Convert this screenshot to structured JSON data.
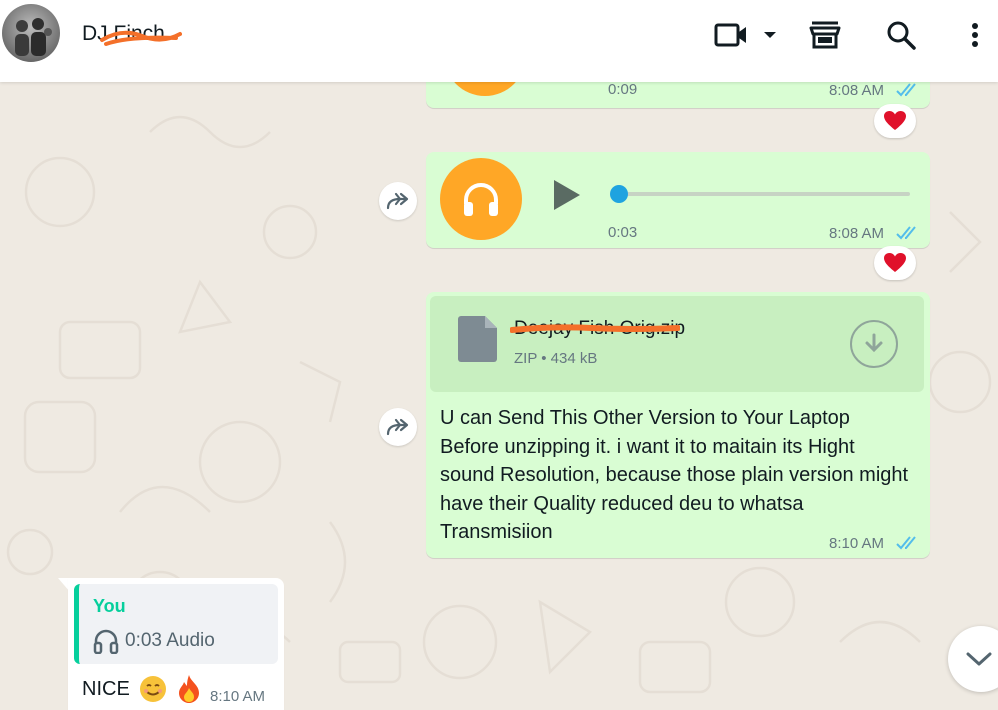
{
  "header": {
    "contact_name": "DJ Finch",
    "icons": [
      "video-call-icon",
      "dropdown-chevron-icon",
      "shop-icon",
      "search-icon",
      "menu-dots-icon"
    ]
  },
  "messages": {
    "audio1": {
      "duration": "0:09",
      "time": "8:08 AM",
      "reaction": "heart"
    },
    "audio2": {
      "duration": "0:03",
      "time": "8:08 AM",
      "reaction": "heart"
    },
    "file": {
      "file_name": "Deejay Fish Orig.zip",
      "file_type": "ZIP",
      "file_size": "434 kB",
      "text": "U can Send This Other Version to Your Laptop Before unzipping it. i want it to maitain its Hight sound Resolution, because those plain version might have their Quality reduced deu to whatsa Transmisiion",
      "time": "8:10 AM"
    },
    "incoming": {
      "quote_author": "You",
      "quote_body": "0:03 Audio",
      "text": "NICE",
      "time": "8:10 AM"
    }
  },
  "colors": {
    "outgoing_bubble": "#d9fdd3",
    "incoming_bubble": "#ffffff",
    "background": "#efeae2",
    "read_ticks": "#53bdeb",
    "audio_avatar": "#ffa726",
    "accent": "#06cf9c"
  }
}
